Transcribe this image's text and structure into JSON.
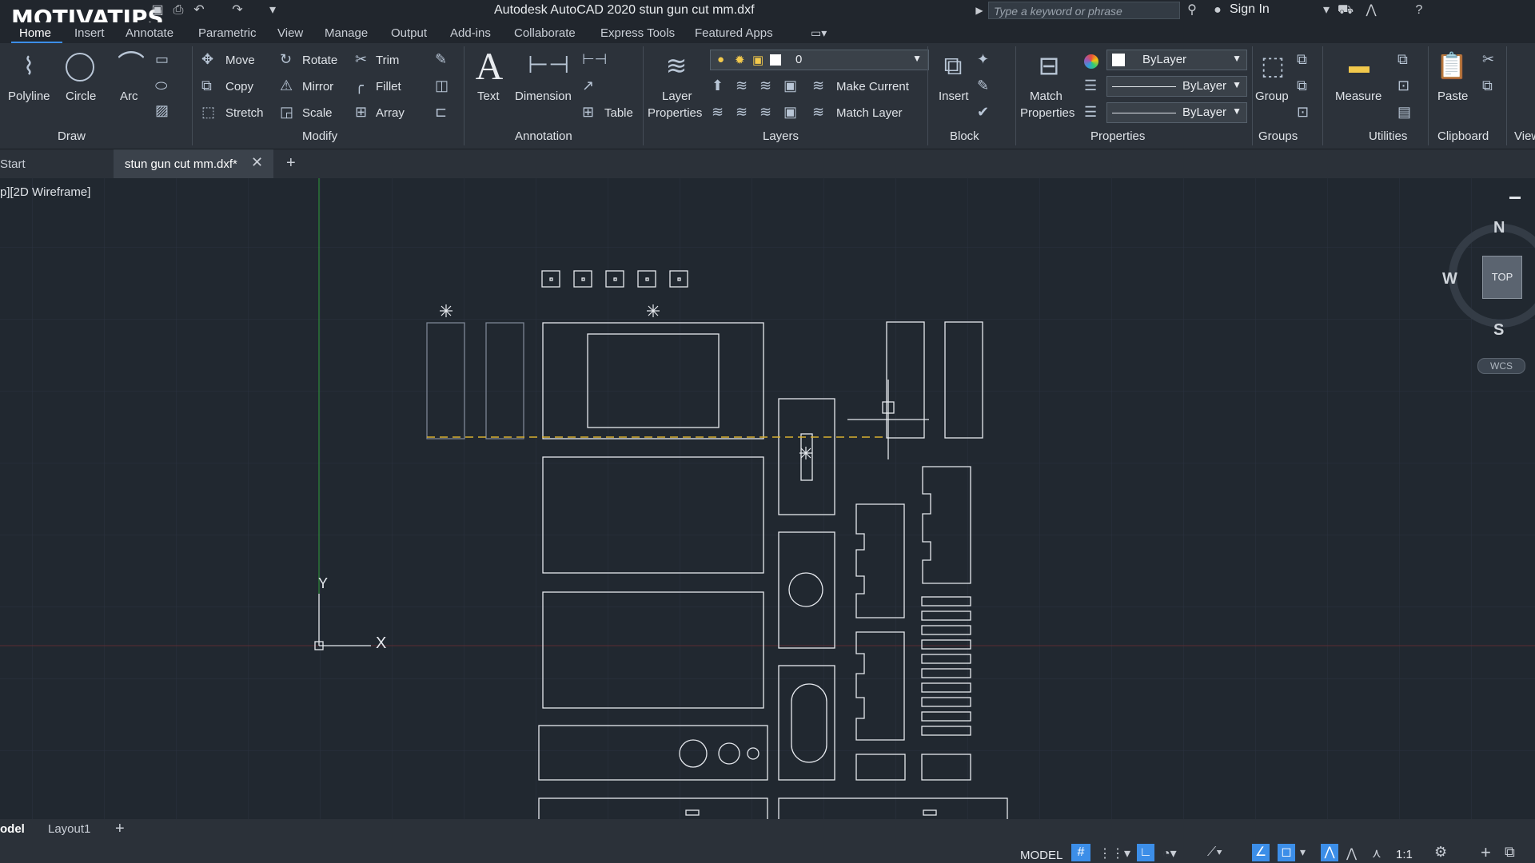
{
  "watermark": "MOTIVATIPS",
  "title": {
    "app_title": "Autodesk AutoCAD 2020   stun gun cut mm.dxf",
    "search_placeholder": "Type a keyword or phrase",
    "sign_in": "Sign In"
  },
  "menu_tabs": [
    "Home",
    "Insert",
    "Annotate",
    "Parametric",
    "View",
    "Manage",
    "Output",
    "Add-ins",
    "Collaborate",
    "Express Tools",
    "Featured Apps"
  ],
  "ribbon": {
    "draw": {
      "polyline": "Polyline",
      "circle": "Circle",
      "arc": "Arc",
      "panel": "Draw"
    },
    "modify": {
      "move": "Move",
      "rotate": "Rotate",
      "trim": "Trim",
      "copy": "Copy",
      "mirror": "Mirror",
      "fillet": "Fillet",
      "stretch": "Stretch",
      "scale": "Scale",
      "array": "Array",
      "panel": "Modify"
    },
    "annotation": {
      "text": "Text",
      "dimension": "Dimension",
      "table": "Table",
      "panel": "Annotation"
    },
    "layers": {
      "layer_properties_line1": "Layer",
      "layer_properties_line2": "Properties",
      "current_layer": "0",
      "make_current": "Make Current",
      "match_layer": "Match Layer",
      "panel": "Layers"
    },
    "block": {
      "insert": "Insert",
      "panel": "Block"
    },
    "properties": {
      "match_line1": "Match",
      "match_line2": "Properties",
      "color": "ByLayer",
      "linetype": "ByLayer",
      "lineweight": "ByLayer",
      "panel": "Properties"
    },
    "groups": {
      "group": "Group",
      "panel": "Groups"
    },
    "utilities": {
      "measure": "Measure",
      "panel": "Utilities"
    },
    "clipboard": {
      "paste": "Paste",
      "panel": "Clipboard"
    },
    "view": {
      "panel": "View"
    }
  },
  "tabs": {
    "start": "Start",
    "document": "stun gun cut mm.dxf*"
  },
  "viewport": {
    "label": "p][2D Wireframe]"
  },
  "viewcube": {
    "north": "N",
    "south": "S",
    "west": "W",
    "top": "TOP",
    "wcs": "WCS"
  },
  "ucs": {
    "x": "X",
    "y": "Y"
  },
  "layout_tabs": {
    "model": "odel",
    "layout1": "Layout1"
  },
  "status": {
    "model": "MODEL",
    "scale": "1:1"
  },
  "colors": {
    "background": "#212830",
    "ribbon": "#2c323a",
    "accent": "#3c8ee8",
    "yaxis": "#2f9a3a",
    "xaxis": "#8a3a3a",
    "dashed": "#d9b030"
  }
}
